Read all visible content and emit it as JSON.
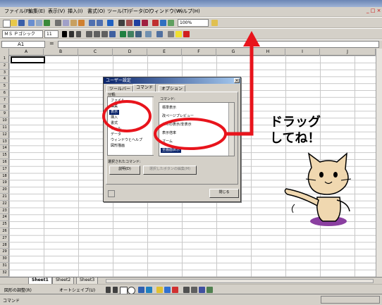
{
  "menu": [
    "ファイル(F)",
    "編集(E)",
    "表示(V)",
    "挿入(I)",
    "書式(O)",
    "ツール(T)",
    "データ(D)",
    "ウィンドウ(W)",
    "ヘルプ(H)"
  ],
  "toolbar": {
    "zoom_value": "100%",
    "font_name": "ＭＳ Ｐゴシック",
    "font_size": "11"
  },
  "formula_bar": {
    "name_box": "A1",
    "function_symbol": "="
  },
  "columns": [
    "A",
    "B",
    "C",
    "D",
    "E",
    "F",
    "G",
    "H",
    "I",
    "J"
  ],
  "rows": [
    "1",
    "2",
    "3",
    "4",
    "5",
    "6",
    "7",
    "8",
    "9",
    "10",
    "11",
    "12",
    "13",
    "14",
    "15",
    "16",
    "17",
    "18",
    "19",
    "20",
    "21",
    "22",
    "23",
    "24",
    "25",
    "26",
    "27",
    "28",
    "29",
    "30",
    "31",
    "32"
  ],
  "sheet_tabs": [
    "Sheet1",
    "Sheet2",
    "Sheet3"
  ],
  "status_bar": {
    "text": "コマンド"
  },
  "draw_toolbar": {
    "draw_label": "図形の調整(R)",
    "autoshapes_label": "オートシェイプ(U)"
  },
  "dialog": {
    "title": "ユーザー設定",
    "tabs": [
      "ツールバー",
      "コマンド",
      "オプション"
    ],
    "categories_label": "分類:",
    "commands_label": "コマンド:",
    "categories": [
      "ファイル",
      "編集",
      "表示",
      "挿入",
      "書式",
      "ツール",
      "データ",
      "ウィンドウとヘルプ",
      "図形描画"
    ],
    "selected_category": "表示",
    "commands": [
      "標準表示",
      "改ページプレビュー",
      "セルの表示/非表示",
      "表示倍率",
      "ズーム",
      "全画面表示"
    ],
    "selected_command": "全画面表示",
    "selected_label": "選択されたコマンド:",
    "description_button": "説明(D)",
    "modify_button": "選択したボタンの編集(M)",
    "close_button": "閉じる"
  },
  "annotation": {
    "line1": "ドラッグ",
    "line2": "してね！",
    "color": "#e8141c",
    "cat_color": "#f0d8b0"
  }
}
